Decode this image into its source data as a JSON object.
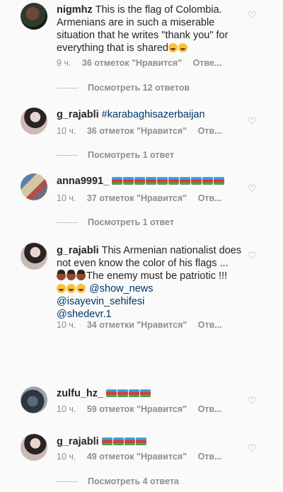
{
  "comments": [
    {
      "username": "nigmhz",
      "text": "This is the flag of Colombia. Armenians are in such a miserable situation that he writes \"thank you\" for everything that is shared",
      "time": "9 ч.",
      "likes": "36 отметок \"Нравится\"",
      "reply": "Отве..."
    },
    {
      "username": "g_rajabli",
      "text": "#karabaghisazerbaijan",
      "time": "10 ч.",
      "likes": "36 отметок \"Нравится\"",
      "reply": "Отв..."
    },
    {
      "username": "anna9991_",
      "text": "",
      "time": "10 ч.",
      "likes": "37 отметок \"Нравится\"",
      "reply": "Отв..."
    },
    {
      "username": "g_rajabli",
      "text": "This Armenian nationalist does not even know the color of his flags ...",
      "text2": "The enemy must be patriotic !!!",
      "mention1": "@show_news",
      "mention2": "@isayevin_sehifesi",
      "mention3": "@shedevr.1",
      "time": "10 ч.",
      "likes": "34 отметки \"Нравится\"",
      "reply": "Отв..."
    },
    {
      "username": "zulfu_hz_",
      "text": "",
      "time": "10 ч.",
      "likes": "59 отметок \"Нравится\"",
      "reply": "Отв..."
    },
    {
      "username": "g_rajabli",
      "text": "",
      "time": "10 ч.",
      "likes": "49 отметок \"Нравится\"",
      "reply": "Отв..."
    }
  ],
  "view_replies": {
    "r1": "Посмотреть 12 ответов",
    "r2": "Посмотреть 1 ответ",
    "r3": "Посмотреть 1 ответ",
    "r4": "Посмотреть 4 ответа"
  },
  "colors": {
    "background": "#fafafa",
    "text": "#262626",
    "meta": "#8e8e8e"
  }
}
